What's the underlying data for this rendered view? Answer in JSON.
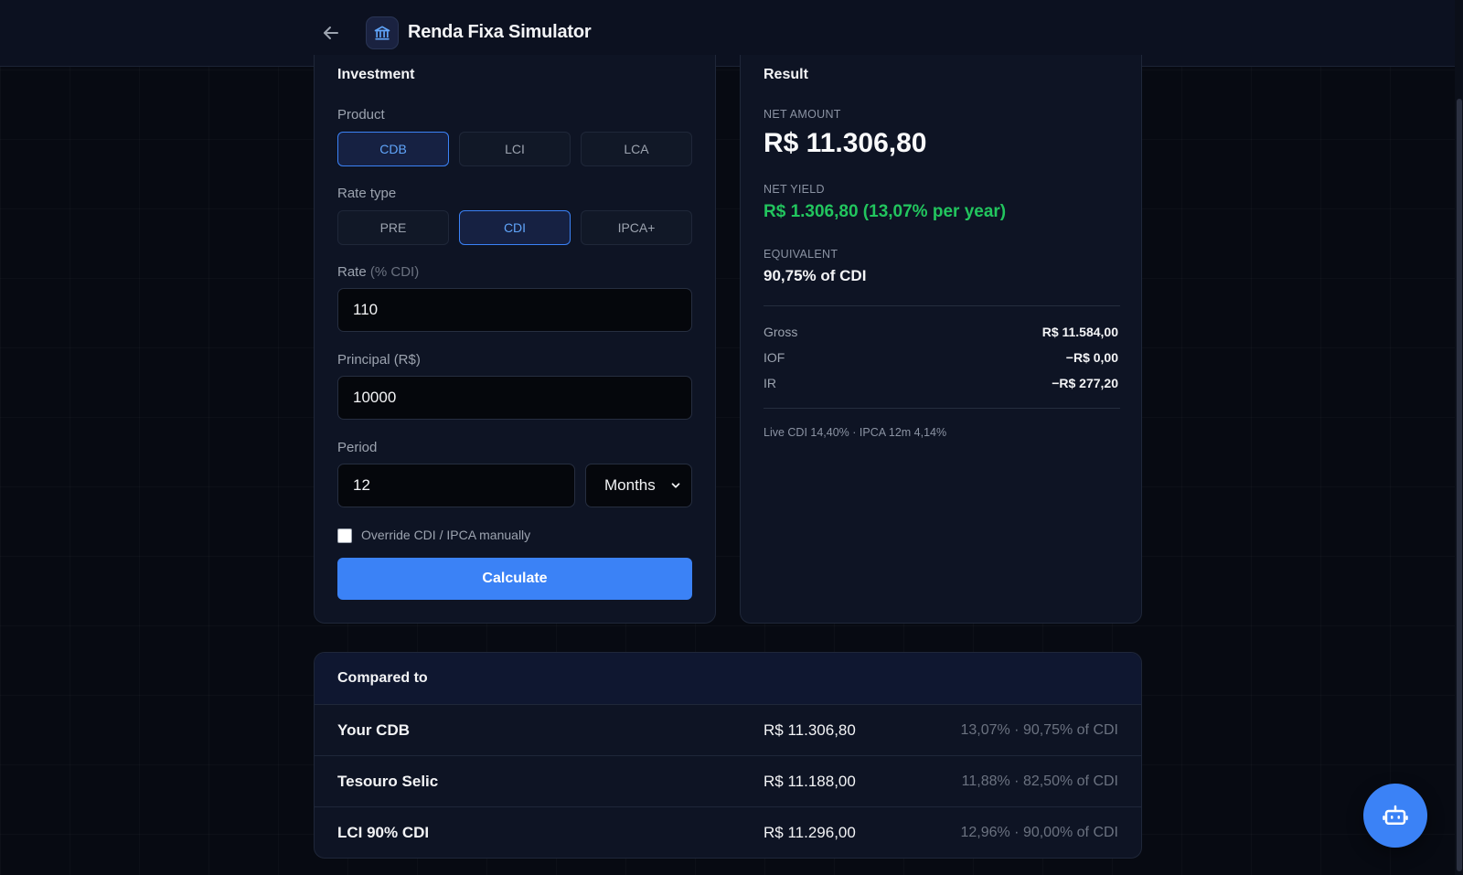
{
  "header": {
    "title": "Renda Fixa Simulator"
  },
  "investment": {
    "title": "Investment",
    "product_label": "Product",
    "products": [
      "CDB",
      "LCI",
      "LCA"
    ],
    "product_selected": "CDB",
    "rate_type_label": "Rate type",
    "rate_types": [
      "PRE",
      "CDI",
      "IPCA+"
    ],
    "rate_type_selected": "CDI",
    "rate_label": "Rate",
    "rate_unit": "(% CDI)",
    "rate_value": "110",
    "principal_label": "Principal (R$)",
    "principal_value": "10000",
    "period_label": "Period",
    "period_value": "12",
    "period_unit": "Months",
    "override_label": "Override CDI / IPCA manually",
    "override_checked": false,
    "calculate_label": "Calculate"
  },
  "result": {
    "title": "Result",
    "net_amount_label": "NET AMOUNT",
    "net_amount": "R$ 11.306,80",
    "net_yield_label": "NET YIELD",
    "net_yield": "R$ 1.306,80 (13,07% per year)",
    "equivalent_label": "EQUIVALENT",
    "equivalent": "90,75% of CDI",
    "breakdown": [
      {
        "label": "Gross",
        "value": "R$ 11.584,00"
      },
      {
        "label": "IOF",
        "value": "−R$ 0,00"
      },
      {
        "label": "IR",
        "value": "−R$ 277,20"
      }
    ],
    "footnote": "Live CDI 14,40% · IPCA 12m 4,14%"
  },
  "compare": {
    "title": "Compared to",
    "rows": [
      {
        "name": "Your CDB",
        "amount": "R$ 11.306,80",
        "meta": "13,07% · 90,75% of CDI"
      },
      {
        "name": "Tesouro Selic",
        "amount": "R$ 11.188,00",
        "meta": "11,88% · 82,50% of CDI"
      },
      {
        "name": "LCI 90% CDI",
        "amount": "R$ 11.296,00",
        "meta": "12,96% · 90,00% of CDI"
      }
    ]
  },
  "colors": {
    "accent": "#3b82f6",
    "positive": "#22c55e",
    "background": "#070a12",
    "card": "#0e1424"
  },
  "icons": {
    "back": "arrow-left-icon",
    "app": "bank-icon",
    "assistant": "robot-icon"
  }
}
